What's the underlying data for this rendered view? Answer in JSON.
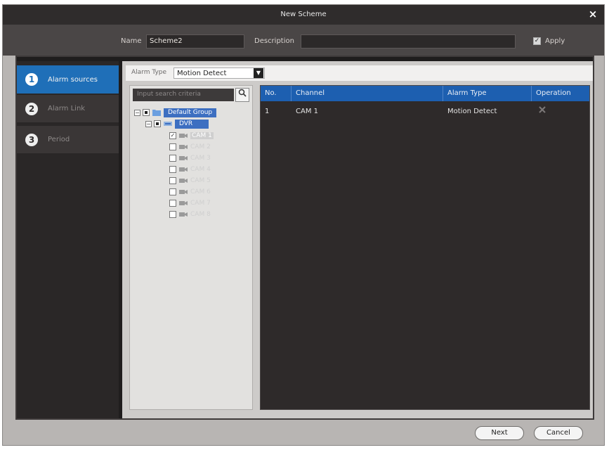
{
  "window": {
    "title": "New Scheme",
    "close_glyph": "×"
  },
  "form": {
    "name_label": "Name",
    "name_value": "Scheme2",
    "description_label": "Description",
    "description_value": "",
    "apply_label": "Apply",
    "apply_checked": true
  },
  "steps": [
    {
      "num": "1",
      "label": "Alarm sources"
    },
    {
      "num": "2",
      "label": "Alarm Link"
    },
    {
      "num": "3",
      "label": "Period"
    }
  ],
  "alarm_type": {
    "label": "Alarm Type",
    "value": "Motion Detect"
  },
  "search": {
    "placeholder": "Input search criteria"
  },
  "tree": {
    "group": "Default Group",
    "device": "DVR",
    "cameras": [
      "CAM 1",
      "CAM 2",
      "CAM 3",
      "CAM 4",
      "CAM 5",
      "CAM 6",
      "CAM 7",
      "CAM 8"
    ],
    "checked_camera": "CAM 1"
  },
  "table": {
    "columns": [
      "No.",
      "Channel",
      "Alarm Type",
      "Operation"
    ],
    "rows": [
      {
        "no": "1",
        "channel": "CAM 1",
        "alarm_type": "Motion Detect",
        "operation_icon": "delete-x-icon"
      }
    ]
  },
  "buttons": {
    "next": "Next",
    "cancel": "Cancel"
  },
  "colors": {
    "accent": "#1f6fb8",
    "header_blue": "#1d5fb0",
    "dark_bg": "#1f1d1d"
  }
}
